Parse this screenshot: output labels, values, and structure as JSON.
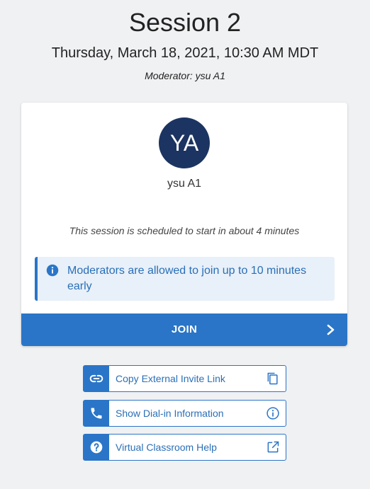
{
  "header": {
    "title": "Session 2",
    "datetime": "Thursday, March 18, 2021, 10:30 AM MDT",
    "moderator": "Moderator: ysu A1"
  },
  "card": {
    "avatar_initials": "YA",
    "avatar_name": "ysu A1",
    "schedule_text": "This session is scheduled to start in about 4 minutes",
    "info_text": "Moderators are allowed to join up to 10 minutes early",
    "join_label": "JOIN"
  },
  "actions": [
    {
      "label": "Copy External Invite Link",
      "icon": "link-icon",
      "trailing_icon": "copy-icon"
    },
    {
      "label": "Show Dial-in Information",
      "icon": "phone-icon",
      "trailing_icon": "info-circle-icon"
    },
    {
      "label": "Virtual Classroom Help",
      "icon": "help-icon",
      "trailing_icon": "external-link-icon"
    }
  ],
  "colors": {
    "accent": "#2a75c7",
    "avatar": "#1c3461",
    "background": "#f0f1f3",
    "info_bg": "#e8f0f9"
  }
}
